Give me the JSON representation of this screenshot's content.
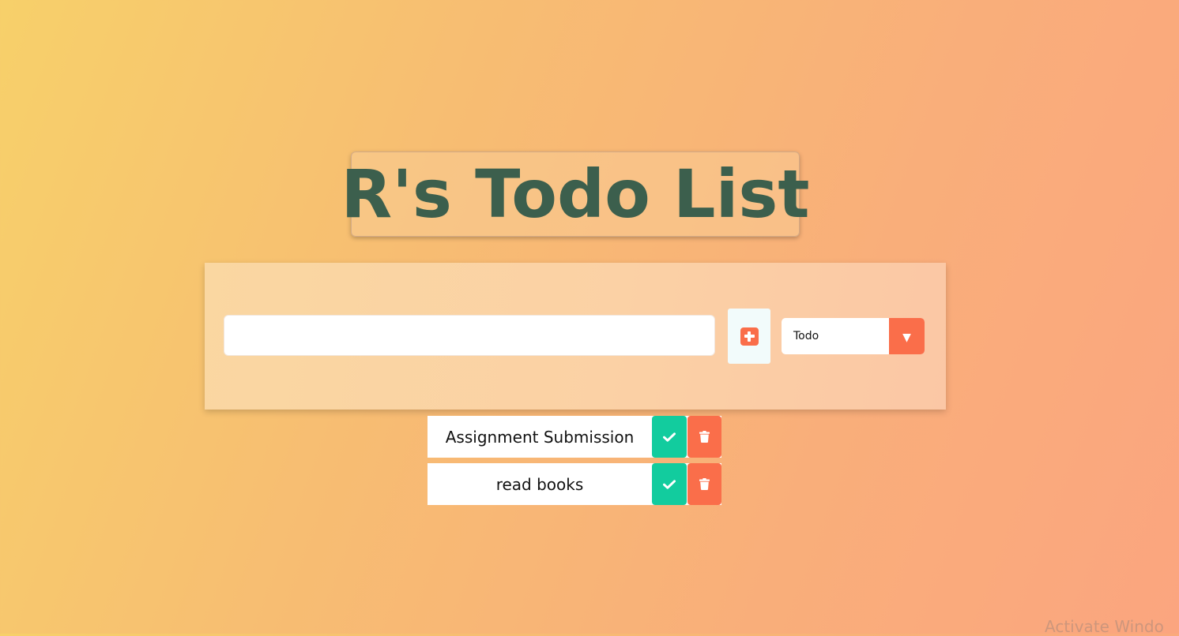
{
  "header": {
    "title": "R's Todo List"
  },
  "form": {
    "input_value": "",
    "input_placeholder": "",
    "add_icon": "plus-square-icon",
    "filter": {
      "selected": "Todo",
      "options": [
        "Todo"
      ],
      "arrow_icon": "caret-down-icon"
    }
  },
  "todos": [
    {
      "text": "Assignment Submission",
      "complete_icon": "check-icon",
      "delete_icon": "trash-icon"
    },
    {
      "text": "read books",
      "complete_icon": "check-icon",
      "delete_icon": "trash-icon"
    }
  ],
  "colors": {
    "accent": "#fa6e4a",
    "complete": "#12cc9e",
    "title": "#3c5f4d"
  },
  "watermark": {
    "text": "Activate Windo"
  }
}
